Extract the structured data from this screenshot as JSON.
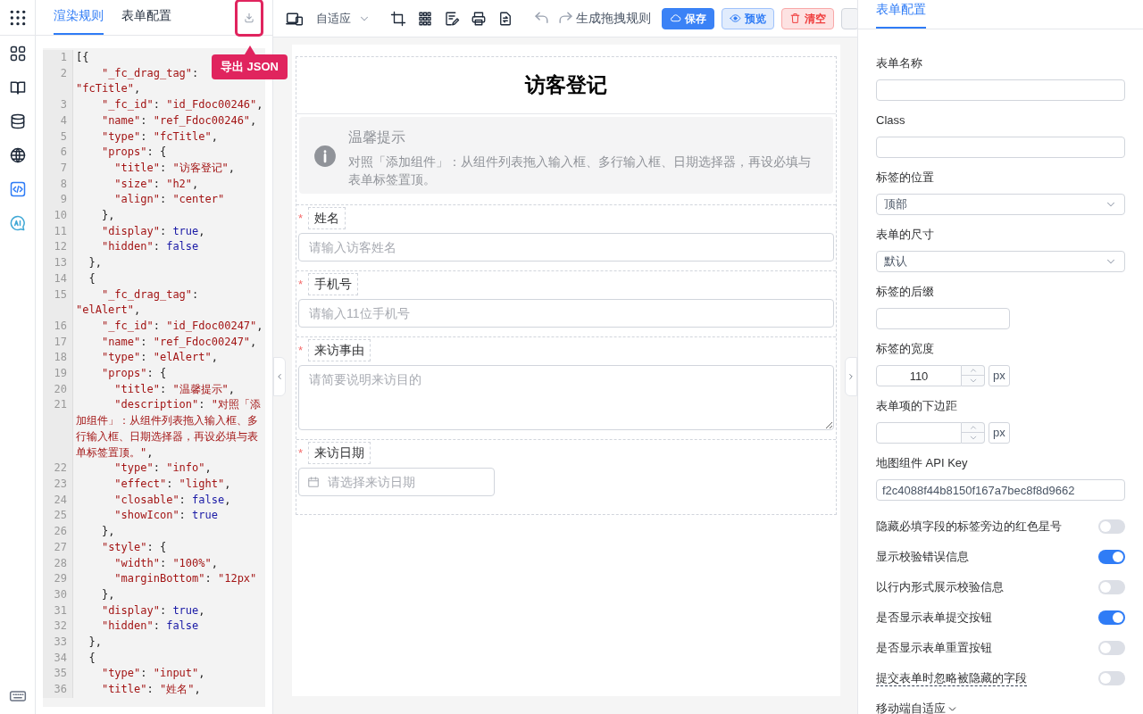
{
  "rail": {
    "items": [
      {
        "kind": "blocks",
        "selected": false
      },
      {
        "kind": "book",
        "selected": false
      },
      {
        "kind": "database",
        "selected": false
      },
      {
        "kind": "globe",
        "selected": false
      },
      {
        "kind": "code",
        "selected": true
      },
      {
        "kind": "ai",
        "selected": false
      }
    ]
  },
  "left_panel": {
    "tabs": [
      {
        "label": "渲染规则",
        "selected": true
      },
      {
        "label": "表单配置",
        "selected": false
      }
    ],
    "export_tooltip": "导出 JSON",
    "code": [
      {
        "n": "1",
        "text": "[{"
      },
      {
        "n": "2",
        "text": "    \"_fc_drag_tag\": \"fcTitle\","
      },
      {
        "n": "3",
        "text": "    \"_fc_id\": \"id_Fdoc00246\","
      },
      {
        "n": "4",
        "text": "    \"name\": \"ref_Fdoc00246\","
      },
      {
        "n": "5",
        "text": "    \"type\": \"fcTitle\","
      },
      {
        "n": "6",
        "text": "    \"props\": {"
      },
      {
        "n": "7",
        "text": "      \"title\": \"访客登记\","
      },
      {
        "n": "8",
        "text": "      \"size\": \"h2\","
      },
      {
        "n": "9",
        "text": "      \"align\": \"center\""
      },
      {
        "n": "10",
        "text": "    },"
      },
      {
        "n": "11",
        "text": "    \"display\": true,"
      },
      {
        "n": "12",
        "text": "    \"hidden\": false"
      },
      {
        "n": "13",
        "text": "  },"
      },
      {
        "n": "14",
        "text": "  {"
      },
      {
        "n": "15",
        "text": "    \"_fc_drag_tag\": \"elAlert\","
      },
      {
        "n": "16",
        "text": "    \"_fc_id\": \"id_Fdoc00247\","
      },
      {
        "n": "17",
        "text": "    \"name\": \"ref_Fdoc00247\","
      },
      {
        "n": "18",
        "text": "    \"type\": \"elAlert\","
      },
      {
        "n": "19",
        "text": "    \"props\": {"
      },
      {
        "n": "20",
        "text": "      \"title\": \"温馨提示\","
      },
      {
        "n": "21",
        "text": "      \"description\": \"对照「添加组件」：从组件列表拖入输入框、多行输入框、日期选择器，再设必填与表单标签置顶。\","
      },
      {
        "n": "22",
        "text": "      \"type\": \"info\","
      },
      {
        "n": "23",
        "text": "      \"effect\": \"light\","
      },
      {
        "n": "24",
        "text": "      \"closable\": false,"
      },
      {
        "n": "25",
        "text": "      \"showIcon\": true"
      },
      {
        "n": "26",
        "text": "    },"
      },
      {
        "n": "27",
        "text": "    \"style\": {"
      },
      {
        "n": "28",
        "text": "      \"width\": \"100%\","
      },
      {
        "n": "29",
        "text": "      \"marginBottom\": \"12px\""
      },
      {
        "n": "30",
        "text": "    },"
      },
      {
        "n": "31",
        "text": "    \"display\": true,"
      },
      {
        "n": "32",
        "text": "    \"hidden\": false"
      },
      {
        "n": "33",
        "text": "  },"
      },
      {
        "n": "34",
        "text": "  {"
      },
      {
        "n": "35",
        "text": "    \"type\": \"input\","
      },
      {
        "n": "36",
        "text": "    \"title\": \"姓名\","
      }
    ]
  },
  "toolbar": {
    "device_select": "自适应",
    "generate_link": "生成拖拽规则",
    "buttons": [
      {
        "kind": "primary",
        "label": "保存"
      },
      {
        "kind": "info",
        "label": "预览"
      },
      {
        "kind": "danger",
        "label": "清空"
      }
    ]
  },
  "form": {
    "title": "访客登记",
    "alert": {
      "title": "温馨提示",
      "description": "对照「添加组件」：从组件列表拖入输入框、多行输入框、日期选择器，再设必填与表单标签置顶。"
    },
    "fields": [
      {
        "kind": "input",
        "label": "姓名",
        "required_mark": "*",
        "placeholder": "请输入访客姓名"
      },
      {
        "kind": "input",
        "label": "手机号",
        "required_mark": "*",
        "placeholder": "请输入11位手机号"
      },
      {
        "kind": "textarea",
        "label": "来访事由",
        "required_mark": "*",
        "placeholder": "请简要说明来访目的"
      },
      {
        "kind": "date",
        "label": "来访日期",
        "required_mark": "*",
        "placeholder": "请选择来访日期"
      }
    ]
  },
  "right_panel": {
    "tab": {
      "label": "表单配置",
      "selected": true
    },
    "settings": [
      {
        "kind": "text",
        "label": "表单名称"
      },
      {
        "kind": "text",
        "label": "Class"
      },
      {
        "kind": "select",
        "label": "标签的位置",
        "value": "顶部"
      },
      {
        "kind": "select",
        "label": "表单的尺寸",
        "value": "默认"
      },
      {
        "kind": "short",
        "label": "标签的后缀"
      },
      {
        "kind": "number",
        "label": "标签的宽度",
        "value": "110",
        "unit": "px"
      },
      {
        "kind": "number",
        "label": "表单项的下边距",
        "unit": "px"
      },
      {
        "kind": "text",
        "label": "地图组件 API Key",
        "value": "f2c4088f44b8150f167a7bec8f8d9662"
      },
      {
        "kind": "switch",
        "label": "隐藏必填字段的标签旁边的红色星号",
        "on": false
      },
      {
        "kind": "switch",
        "label": "显示校验错误信息",
        "on": true
      },
      {
        "kind": "switch",
        "label": "以行内形式展示校验信息",
        "on": false
      },
      {
        "kind": "switch",
        "label": "是否显示表单提交按钮",
        "on": true
      },
      {
        "kind": "switch",
        "label": "是否显示表单重置按钮",
        "on": false
      },
      {
        "kind": "switch",
        "label": "提交表单时忽略被隐藏的字段",
        "on": false,
        "hint": true
      },
      {
        "kind": "collapse",
        "label": "移动端自适应"
      }
    ]
  }
}
